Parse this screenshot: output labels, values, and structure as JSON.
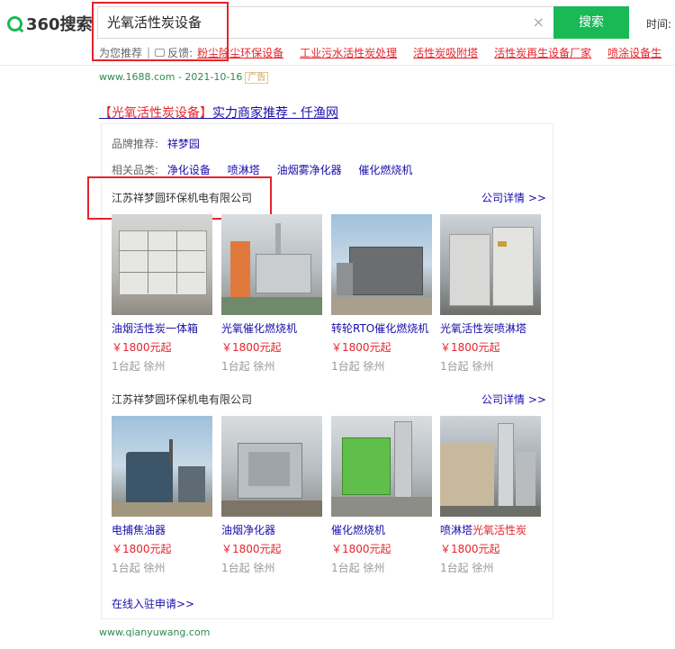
{
  "header": {
    "logo_text": "360搜索",
    "query": "光氧活性炭设备",
    "clear_icon": "×",
    "search_button": "搜索",
    "time_label": "时间: 全"
  },
  "recommend": {
    "label": "为您推荐",
    "separator": "|",
    "feedback_label": "反馈:",
    "links": [
      "粉尘除尘环保设备",
      "工业污水活性炭处理",
      "活性炭吸附塔",
      "活性炭再生设备厂家",
      "喷涂设备生"
    ]
  },
  "ad": {
    "url": "www.1688.com - 2021-10-16",
    "badge": "广告",
    "title_highlight": "【光氧活性炭设备】",
    "title_rest": "实力商家推荐 - 仟渔网"
  },
  "panel": {
    "brand_label": "品牌推荐:",
    "brand_value": "祥梦园",
    "category_label": "相关品类:",
    "categories": [
      "净化设备",
      "喷淋塔",
      "油烟雾净化器",
      "催化燃烧机"
    ],
    "join_link": "在线入驻申请>>"
  },
  "companies": [
    {
      "name": "江苏祥梦圆环保机电有限公司",
      "detail_link": "公司详情 >>",
      "products": [
        {
          "name": "油烟活性炭一体箱",
          "price": "￥1800元起",
          "meta": "1台起  徐州",
          "image": "grey-filter-boxes"
        },
        {
          "name": "光氧催化燃烧机",
          "price": "￥1800元起",
          "meta": "1台起  徐州",
          "image": "workshop-machine"
        },
        {
          "name": "转轮RTO催化燃烧机",
          "price": "￥1800元起",
          "meta": "1台起  徐州",
          "image": "large-unit-outdoor"
        },
        {
          "name_plain": "光氧活性炭喷淋塔",
          "name_red": "",
          "price": "￥1800元起",
          "meta": "1台起  徐州",
          "image": "cabinet-stack"
        }
      ]
    },
    {
      "name": "江苏祥梦圆环保机电有限公司",
      "detail_link": "公司详情 >>",
      "products": [
        {
          "name": "电捕焦油器",
          "price": "￥1800元起",
          "meta": "1台起  徐州",
          "image": "tank-construction"
        },
        {
          "name": "油烟净化器",
          "price": "￥1800元起",
          "meta": "1台起  徐州",
          "image": "duct-box"
        },
        {
          "name": "催化燃烧机",
          "price": "￥1800元起",
          "meta": "1台起  徐州",
          "image": "green-unit"
        },
        {
          "name_plain": "喷淋塔",
          "name_red": "光氧活性炭",
          "price": "￥1800元起",
          "meta": "1台起  徐州",
          "image": "tower-factory"
        }
      ]
    }
  ],
  "footer": {
    "url": "www.qianyuwang.com"
  },
  "colors": {
    "brand_green": "#19b955",
    "highlight_red": "#e5242b",
    "link_blue": "#1a0dab",
    "url_green": "#2f8a4f"
  }
}
